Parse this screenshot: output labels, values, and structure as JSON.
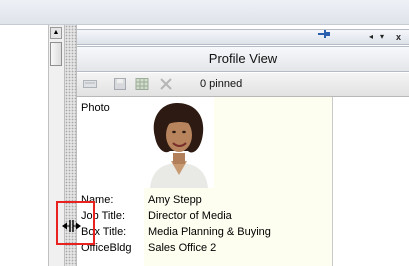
{
  "panel": {
    "title": "Profile View",
    "controls": {
      "scroll_left_glyph": "◂",
      "dropdown_glyph": "▾",
      "close_glyph": "x"
    }
  },
  "toolbar": {
    "pinned_label": "0 pinned",
    "icons": [
      "card-icon",
      "save-icon",
      "grid-icon",
      "unpin-icon"
    ]
  },
  "profile": {
    "photo_label": "Photo",
    "fields": [
      {
        "label": "Name:",
        "value": "Amy Stepp"
      },
      {
        "label": "Job Title:",
        "value": "Director of Media"
      },
      {
        "label": "Box Title:",
        "value": "Media Planning & Buying"
      },
      {
        "label": "OfficeBldg",
        "value": "Sales Office 2"
      }
    ]
  },
  "scrollbar": {
    "up_glyph": "▲"
  },
  "colors": {
    "value_background": "#fdfdf0",
    "highlight_box": "#e8221f",
    "pin_blue": "#2a5fb0"
  }
}
